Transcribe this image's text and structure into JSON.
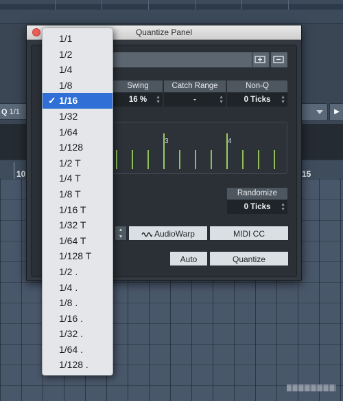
{
  "panel": {
    "title": "Quantize Panel",
    "headers": {
      "swing": "Swing",
      "catch_range": "Catch Range",
      "non_q": "Non-Q"
    },
    "values": {
      "swing": "16 %",
      "catch_range": "-",
      "non_q": "0 Ticks"
    },
    "grid_labels": [
      "3",
      "4"
    ],
    "randomize": {
      "label": "Randomize",
      "value": "0 Ticks"
    },
    "buttons": {
      "audiowarp": "AudioWarp",
      "midi_cc": "MIDI CC",
      "auto": "Auto",
      "quantize": "Quantize"
    }
  },
  "grid_menu": {
    "selected": "1/16",
    "options": [
      "1/1",
      "1/2",
      "1/4",
      "1/8",
      "1/16",
      "1/32",
      "1/64",
      "1/128",
      "1/2 T",
      "1/4 T",
      "1/8 T",
      "1/16 T",
      "1/32 T",
      "1/64 T",
      "1/128 T",
      "1/2 .",
      "1/4 .",
      "1/8 .",
      "1/16 .",
      "1/32 .",
      "1/64 .",
      "1/128 ."
    ]
  },
  "toolbar": {
    "quantize_short": "Q",
    "quantize_value": "1/1"
  },
  "ruler": {
    "left": "10",
    "right": "15"
  },
  "icons": {
    "checkmark": "checkmark-icon",
    "close": "close-icon",
    "audiowarp": "waveform-icon",
    "preset_save": "save-preset-icon",
    "preset_remove": "remove-preset-icon"
  },
  "colors": {
    "accent": "#2f6fd6",
    "grid_line": "#8fbf5a",
    "close": "#ee5c57"
  }
}
